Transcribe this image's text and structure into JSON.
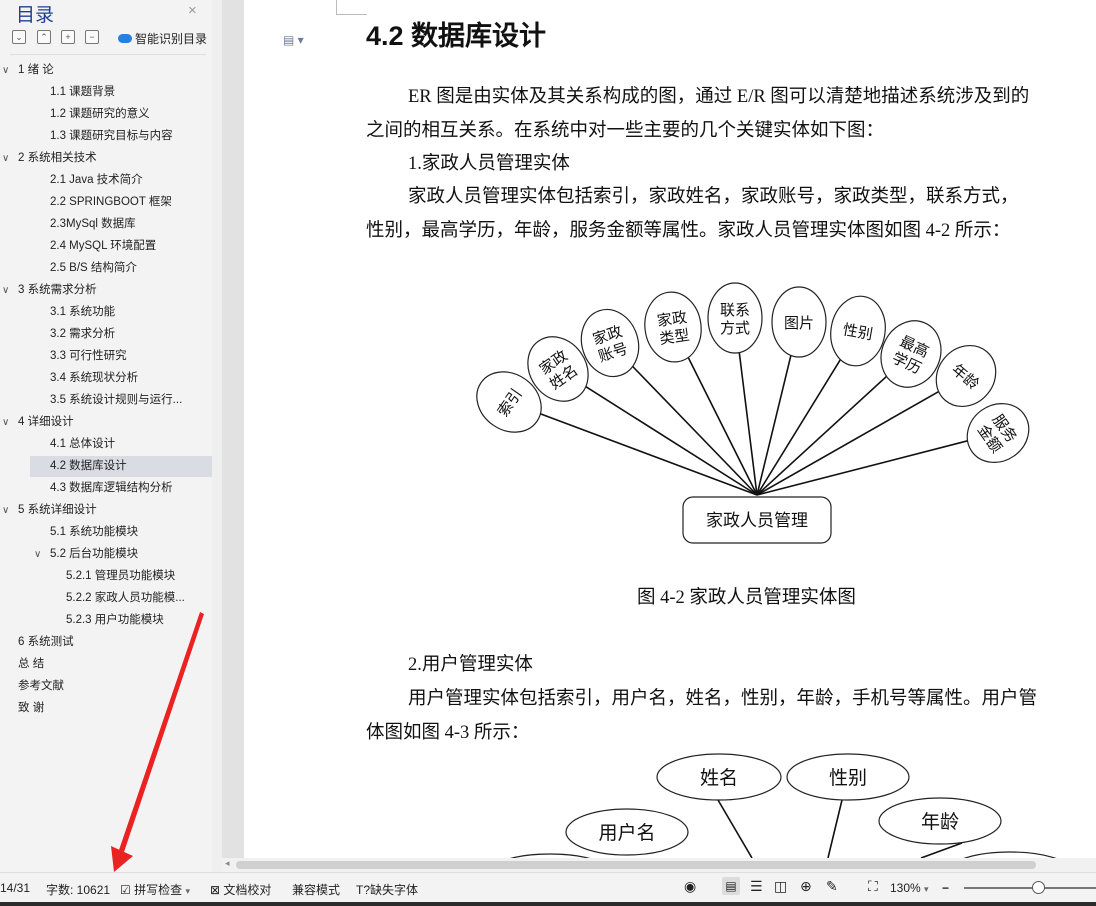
{
  "toc": {
    "title": "目录",
    "close_icon": "×",
    "buttons": [
      "expand-all",
      "collapse",
      "add",
      "remove"
    ],
    "smart_label": "智能识别目录",
    "items": [
      {
        "label": "1 绪  论",
        "level": 0,
        "arrow": "∨"
      },
      {
        "label": "1.1 课题背景",
        "level": 1
      },
      {
        "label": "1.2 课题研究的意义",
        "level": 1
      },
      {
        "label": "1.3 课题研究目标与内容",
        "level": 1
      },
      {
        "label": "2 系统相关技术",
        "level": 0,
        "arrow": "∨"
      },
      {
        "label": "2.1 Java 技术简介",
        "level": 1
      },
      {
        "label": "2.2 SPRINGBOOT 框架",
        "level": 1
      },
      {
        "label": "2.3MySql 数据库",
        "level": 1
      },
      {
        "label": "2.4 MySQL 环境配置",
        "level": 1
      },
      {
        "label": "2.5 B/S 结构简介",
        "level": 1
      },
      {
        "label": "3 系统需求分析",
        "level": 0,
        "arrow": "∨"
      },
      {
        "label": "3.1 系统功能",
        "level": 1
      },
      {
        "label": "3.2  需求分析",
        "level": 1
      },
      {
        "label": "3.3 可行性研究",
        "level": 1
      },
      {
        "label": "3.4  系统现状分析",
        "level": 1
      },
      {
        "label": "3.5 系统设计规则与运行...",
        "level": 1
      },
      {
        "label": "4 详细设计",
        "level": 0,
        "arrow": "∨"
      },
      {
        "label": "4.1 总体设计",
        "level": 1
      },
      {
        "label": "4.2  数据库设计",
        "level": 1,
        "selected": true
      },
      {
        "label": "4.3 数据库逻辑结构分析",
        "level": 1
      },
      {
        "label": "5  系统详细设计",
        "level": 0,
        "arrow": "∨"
      },
      {
        "label": "5.1 系统功能模块",
        "level": 1
      },
      {
        "label": "5.2 后台功能模块",
        "level": 1,
        "arrow": "∨"
      },
      {
        "label": "5.2.1 管理员功能模块",
        "level": 2
      },
      {
        "label": "5.2.2 家政人员功能模...",
        "level": 2
      },
      {
        "label": "5.2.3 用户功能模块",
        "level": 2
      },
      {
        "label": "6  系统测试",
        "level": 0
      },
      {
        "label": "总    结",
        "level": 0
      },
      {
        "label": "参考文献",
        "level": 0
      },
      {
        "label": "致    谢",
        "level": 0
      }
    ]
  },
  "document": {
    "heading": "4.2  数据库设计",
    "para1_line1": "ER 图是由实体及其关系构成的图，通过 E/R 图可以清楚地描述系统涉及到的",
    "para1_line2": "之间的相互关系。在系统中对一些主要的几个关键实体如下图：",
    "sec1_title": "1.家政人员管理实体",
    "sec1_line1": "家政人员管理实体包括索引，家政姓名，家政账号，家政类型，联系方式，",
    "sec1_line2": "性别，最高学历，年龄，服务金额等属性。家政人员管理实体图如图 4-2 所示：",
    "diagram1": {
      "center": "家政人员管理",
      "attributes": [
        [
          "索引"
        ],
        [
          "家政",
          "姓名"
        ],
        [
          "家政",
          "账号"
        ],
        [
          "家政",
          "类型"
        ],
        [
          "联系",
          "方式"
        ],
        [
          "图片"
        ],
        [
          "性别"
        ],
        [
          "最高",
          "学历"
        ],
        [
          "年龄"
        ],
        [
          "服务",
          "金额"
        ]
      ]
    },
    "fig1_caption": "图 4-2 家政人员管理实体图",
    "sec2_title": "2.用户管理实体",
    "sec2_line1": "用户管理实体包括索引，用户名，姓名，性别，年龄，手机号等属性。用户管",
    "sec2_line2": "体图如图 4-3 所示：",
    "diagram2": {
      "attributes": [
        "姓名",
        "性别",
        "用户名",
        "年龄"
      ]
    }
  },
  "status": {
    "page": "14/31",
    "word_count": "字数: 10621",
    "spell_check": "拼写检查",
    "doc_proof": "文档校对",
    "compat_mode": "兼容模式",
    "missing_font": "缺失字体",
    "zoom": "130%"
  }
}
